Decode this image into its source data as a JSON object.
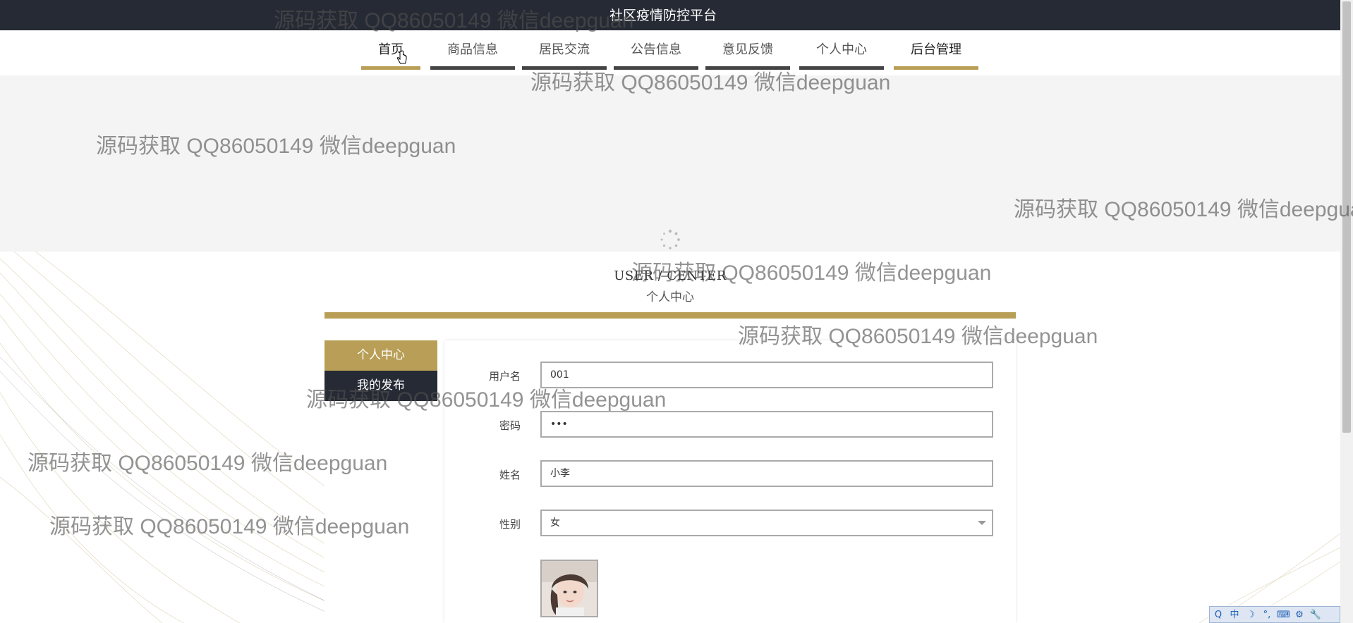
{
  "header": {
    "title": "社区疫情防控平台"
  },
  "nav": {
    "items": [
      {
        "label": "首页"
      },
      {
        "label": "商品信息"
      },
      {
        "label": "居民交流"
      },
      {
        "label": "公告信息"
      },
      {
        "label": "意见反馈"
      },
      {
        "label": "个人中心"
      },
      {
        "label": "后台管理"
      }
    ]
  },
  "section": {
    "title_en": "USER / CENTER",
    "title_cn": "个人中心"
  },
  "sidebar": {
    "items": [
      {
        "label": "个人中心",
        "active": true
      },
      {
        "label": "我的发布",
        "active": false
      }
    ]
  },
  "form": {
    "username": {
      "label": "用户名",
      "value": "001"
    },
    "password": {
      "label": "密码",
      "value": "•••"
    },
    "name": {
      "label": "姓名",
      "value": "小李"
    },
    "gender": {
      "label": "性别",
      "value": "女"
    }
  },
  "watermark": {
    "text": "源码获取 QQ86050149 微信deepguan"
  },
  "colors": {
    "accent": "#b89e56",
    "dark": "#262a34"
  },
  "tray": {
    "icons": [
      "Q",
      "中",
      "☽",
      "°,",
      "⌨",
      "⚙",
      "🔧"
    ]
  }
}
